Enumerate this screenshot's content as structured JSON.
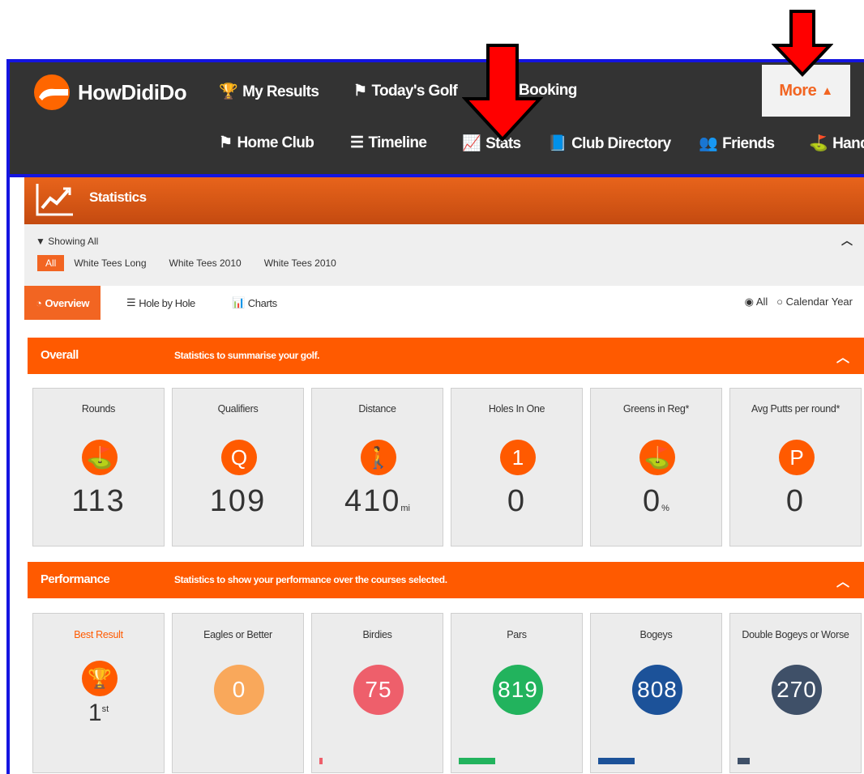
{
  "navbar": {
    "brand": "HowDidiDo",
    "primary": [
      {
        "label": "My Results",
        "icon": "trophy-icon"
      },
      {
        "label": "Today's Golf",
        "icon": "flag-icon"
      },
      {
        "label": "Booking",
        "icon": "calendar-icon"
      }
    ],
    "more_label": "More",
    "secondary": [
      {
        "label": "Home Club",
        "icon": "flag-icon"
      },
      {
        "label": "Timeline",
        "icon": "list-icon"
      },
      {
        "label": "Stats",
        "icon": "line-chart-icon"
      },
      {
        "label": "Club Directory",
        "icon": "book-icon"
      },
      {
        "label": "Friends",
        "icon": "users-icon"
      },
      {
        "label": "Hand",
        "icon": "handicap-icon"
      }
    ]
  },
  "page": {
    "title": "Statistics"
  },
  "filter": {
    "showing": "Showing All",
    "options": [
      "All",
      "White Tees Long",
      "White Tees 2010",
      "White Tees 2010"
    ],
    "selected": "All"
  },
  "tabs": [
    {
      "label": "Overview",
      "icon": "dashboard-icon",
      "active": true
    },
    {
      "label": "Hole by Hole",
      "icon": "list-icon",
      "active": false
    },
    {
      "label": "Charts",
      "icon": "bar-chart-icon",
      "active": false
    }
  ],
  "period": {
    "options": [
      "All",
      "Calendar Year"
    ],
    "selected": "All"
  },
  "overall": {
    "name": "Overall",
    "description": "Statistics to summarise your golf.",
    "cards": [
      {
        "title": "Rounds",
        "icon": "golf-flag-icon",
        "value": "113",
        "unit": ""
      },
      {
        "title": "Qualifiers",
        "icon": "q-letter-icon",
        "value": "109",
        "unit": ""
      },
      {
        "title": "Distance",
        "icon": "walking-icon",
        "value": "410",
        "unit": "mi"
      },
      {
        "title": "Holes In One",
        "icon": "one-icon",
        "value": "0",
        "unit": ""
      },
      {
        "title": "Greens in Reg*",
        "icon": "golf-flag-icon",
        "value": "0",
        "unit": "%"
      },
      {
        "title": "Avg Putts per round*",
        "icon": "p-letter-icon",
        "value": "0",
        "unit": ""
      }
    ]
  },
  "performance": {
    "name": "Performance",
    "description": "Statistics to show your performance over the courses selected.",
    "best_result": {
      "title": "Best Result",
      "icon": "trophy-icon",
      "value": "1",
      "suffix": "st"
    },
    "cards": [
      {
        "title": "Eagles or Better",
        "value": "0",
        "color": "#f9a85b",
        "bar_fraction": 0
      },
      {
        "title": "Birdies",
        "value": "75",
        "color": "#ee5f6b",
        "bar_fraction": 0.03
      },
      {
        "title": "Pars",
        "value": "819",
        "color": "#22b35d",
        "bar_fraction": 0.31
      },
      {
        "title": "Bogeys",
        "value": "808",
        "color": "#1c5299",
        "bar_fraction": 0.31
      },
      {
        "title": "Double Bogeys or Worse",
        "value": "270",
        "color": "#3f5068",
        "bar_fraction": 0.1
      }
    ]
  },
  "colors": {
    "accent": "#ff5a00",
    "navbar": "#333333",
    "annotation_frame": "#1414e0",
    "annotation_arrow": "#ff0000"
  }
}
